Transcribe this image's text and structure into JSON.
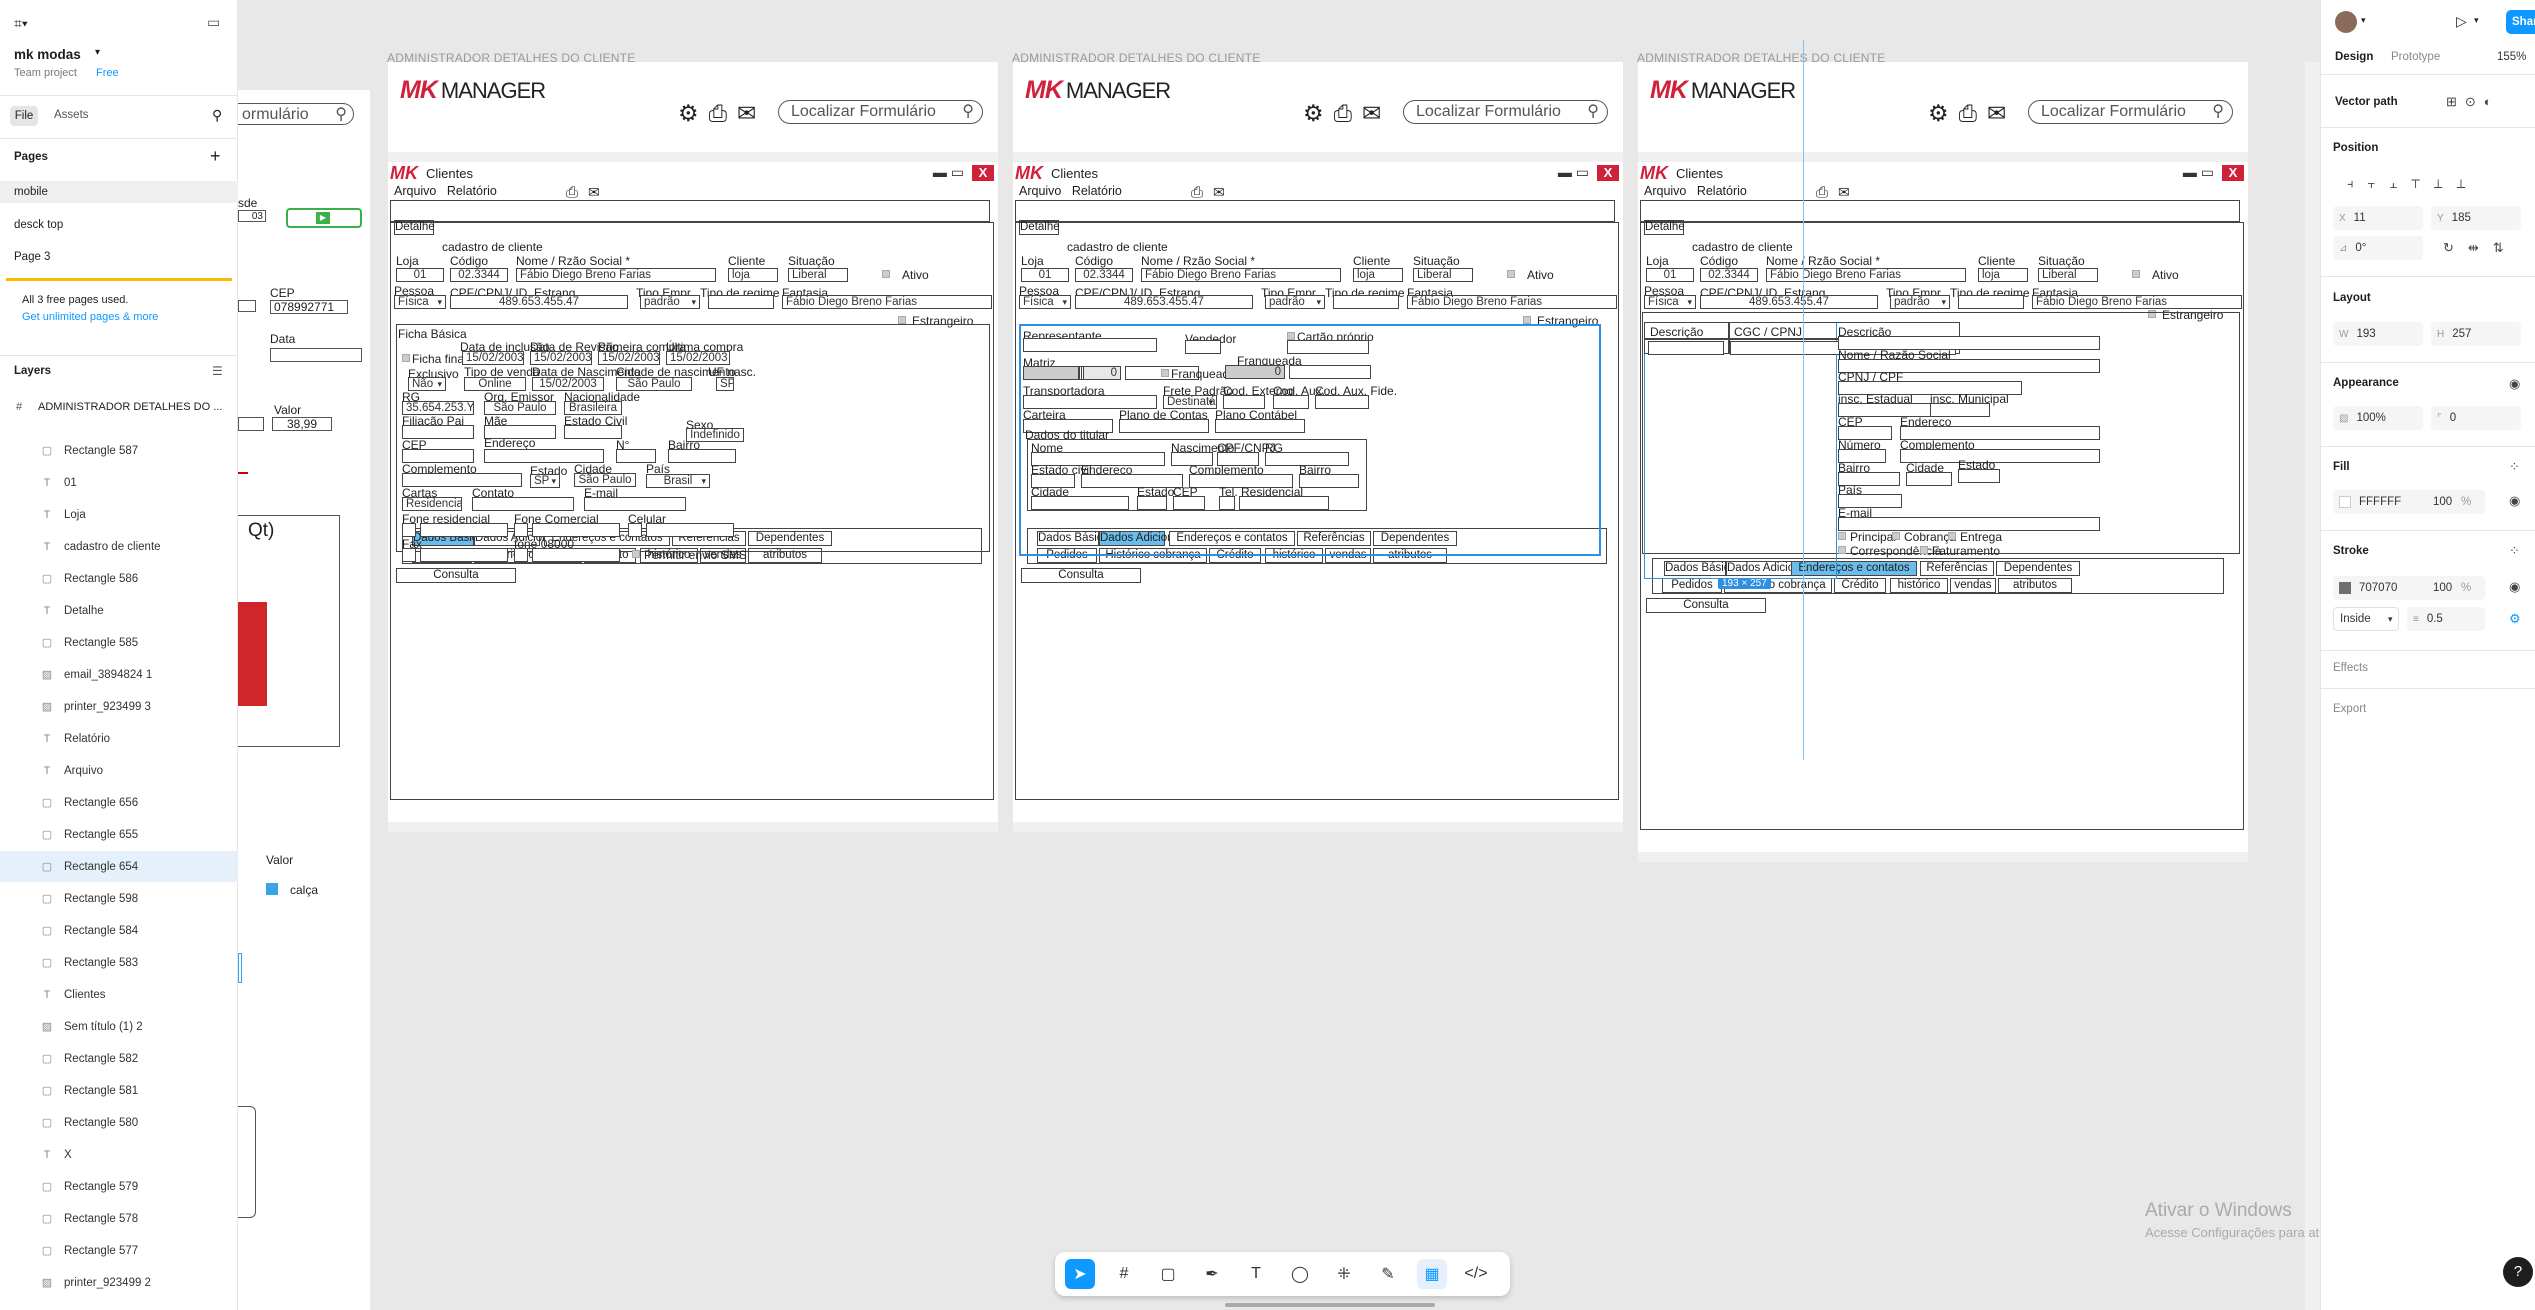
{
  "left_panel": {
    "project": "mk modas",
    "team": "Team project",
    "plan": "Free",
    "tabs": [
      "File",
      "Assets"
    ],
    "pages_title": "Pages",
    "pages": [
      "mobile",
      "desck top",
      "Page 3"
    ],
    "pages_notice": "All 3 free pages used.",
    "pages_link": "Get unlimited pages & more",
    "layers_title": "Layers",
    "frame_layer": "ADMINISTRADOR DETALHES DO ...",
    "layers": [
      {
        "icon": "rect",
        "name": "Rectangle 587"
      },
      {
        "icon": "text",
        "name": "01"
      },
      {
        "icon": "text",
        "name": "Loja"
      },
      {
        "icon": "text",
        "name": "cadastro de cliente"
      },
      {
        "icon": "rect",
        "name": "Rectangle 586"
      },
      {
        "icon": "text",
        "name": "Detalhe"
      },
      {
        "icon": "rect",
        "name": "Rectangle 585"
      },
      {
        "icon": "img",
        "name": "email_3894824 1"
      },
      {
        "icon": "img",
        "name": "printer_923499 3"
      },
      {
        "icon": "text",
        "name": "Relatório"
      },
      {
        "icon": "text",
        "name": "Arquivo"
      },
      {
        "icon": "rect",
        "name": "Rectangle 656"
      },
      {
        "icon": "rect",
        "name": "Rectangle 655"
      },
      {
        "icon": "rect",
        "name": "Rectangle 654"
      },
      {
        "icon": "rect",
        "name": "Rectangle 598"
      },
      {
        "icon": "rect",
        "name": "Rectangle 584"
      },
      {
        "icon": "rect",
        "name": "Rectangle 583"
      },
      {
        "icon": "text",
        "name": "Clientes"
      },
      {
        "icon": "img",
        "name": "Sem título (1) 2"
      },
      {
        "icon": "rect",
        "name": "Rectangle 582"
      },
      {
        "icon": "rect",
        "name": "Rectangle 581"
      },
      {
        "icon": "rect",
        "name": "Rectangle 580"
      },
      {
        "icon": "text",
        "name": "X"
      },
      {
        "icon": "rect",
        "name": "Rectangle 579"
      },
      {
        "icon": "rect",
        "name": "Rectangle 578"
      },
      {
        "icon": "rect",
        "name": "Rectangle 577"
      },
      {
        "icon": "img",
        "name": "printer_923499 2"
      }
    ]
  },
  "partial_frame": {
    "search_text": "ormulário",
    "cep_label": "CEP",
    "cep_value": "078992771",
    "data_label": "Data",
    "valor_label": "Valor",
    "valor_value": "38,99",
    "chart_label": "Qt)",
    "valor_label2": "Valor",
    "legend_item": "calça",
    "sde": "sde",
    "o3": "03"
  },
  "frames": {
    "label": "ADMINISTRADOR DETALHES DO CLIENTE",
    "logo_mk": "MK",
    "logo_manager": "MANAGER",
    "search_placeholder": "Localizar Formulário",
    "window_title": "Clientes",
    "close": "X",
    "menu_arquivo": "Arquivo",
    "menu_relatorio": "Relatório",
    "tab_detalhe": "Detalhe",
    "section_title": "cadastro de cliente",
    "loja": "Loja",
    "loja_v": "01",
    "codigo": "Código",
    "codigo_v": "02.3344",
    "nome": "Nome / Rzão Social *",
    "nome_v": "Fábio Diego Breno Farias",
    "cliente": "Cliente",
    "cliente_v": "loja",
    "situacao": "Situação",
    "situacao_v": "Liberal",
    "ativo": "Ativo",
    "pessoa": "Pessoa",
    "pessoa_v": "Física",
    "cpf": "CPF/CPNJ/ ID. Estrang",
    "cpf_v": "489.653.455.47",
    "tipo_empr": "Tipo Empr.",
    "tipo_empr_v": "padrão",
    "tipo_regime": "Tipo de regime",
    "fantasia": "Fantasia",
    "fantasia_v": "Fábio Diego Breno Farias",
    "estrangeiro": "Estrangeiro",
    "bottom_tabs": [
      "Dados Básicos",
      "Dados Adicionais",
      "Endereços e contatos",
      "Referências",
      "Dependentes"
    ],
    "bottom_tabs2": [
      "Pedidos",
      "Histórico cobrança",
      "Crédito",
      "histórico",
      "vendas",
      "atributos"
    ],
    "consulta": "Consulta"
  },
  "f1": {
    "ficha": "Ficha Básica",
    "ficha_fin": "Ficha financ.",
    "data_inclusao": "Data de inclusão",
    "data_inclusao_v": "15/02/2003",
    "data_revisao": "Data de Revisão",
    "data_revisao_v": "15/02/2003",
    "primeira": "Primeira compra",
    "primeira_v": "15/02/2003",
    "ultima": "Última compra",
    "ultima_v": "15/02/2003",
    "exclusivo": "Exclusivo",
    "exclusivo_v": "Não",
    "tipo_venda": "Tipo de venda",
    "tipo_venda_v": "Online",
    "data_nasc": "Data de Nascimento",
    "data_nasc_v": "15/02/2003",
    "cidade_nasc": "Cidade de nascimento",
    "cidade_nasc_v": "São Paulo",
    "uf": "UF nasc.",
    "uf_v": "SP",
    "rg": "RG",
    "rg_v": "35.654.253.Y",
    "org": "Org. Emissor",
    "org_v": "São Paulo",
    "nacionalidade": "Nacionalidade",
    "nacionalidade_v": "Brasileira",
    "filiacao": "Filiação Pai",
    "mae": "Mãe",
    "estado_civil": "Estado Civil",
    "sexo": "Sexo",
    "sexo_v": "Indefinido",
    "cep": "CEP",
    "endereco": "Endereço",
    "numero": "N°",
    "bairro": "Bairro",
    "complemento": "Complemento",
    "estado": "Estado",
    "estado_v": "SP",
    "cidade": "Cidade",
    "cidade_v": "São Paulo",
    "pais": "País",
    "pais_v": "Brasil",
    "cartas": "Cartas",
    "cartas_v": "Residencial",
    "contato": "Contato",
    "email": "E-mail",
    "fone_res": "Fone residencial",
    "fone_com": "Fone Comercial",
    "celular": "Celular",
    "fax": "Fax",
    "fone0800": "fone 08000",
    "sms": "Permitir envio SMS"
  },
  "f2": {
    "representante": "Representante",
    "vendedor": "Vendedor",
    "cartao": "Cartão próprio",
    "matriz": "Matriz",
    "matriz_v": "0",
    "franqueador": "Franqueador",
    "franqueada": "Franqueada",
    "franqueada_v": "0",
    "transportadora": "Transportadora",
    "frete": "Frete Padrão",
    "frete_v": "Destinatário",
    "cod_ext": "Cod. Externo",
    "cod_aux": "Cod. Aux.",
    "cod_aux_fide": "Cod. Aux. Fide.",
    "carteira": "Carteira",
    "plano_contas": "Plano de Contas",
    "plano_contabil": "Plano Contábel",
    "dados_titular": "Dados do titular",
    "nome": "Nome",
    "nascimento": "Nascimento",
    "cpf_cnpj": "CPF/CNPJ",
    "rg": "RG",
    "estado_civil": "Estado civil",
    "endereco": "Endereço",
    "complemento": "Complemento",
    "bairro": "Bairro",
    "cidade": "Cidade",
    "estado": "Estado",
    "cep": "CEP",
    "tel": "Tel. Residencial"
  },
  "f3": {
    "descricao": "Descrição",
    "cgc": "CGC / CPNJ",
    "size_badge": "193 × 257",
    "descricao2": "Descrição",
    "nome_razao": "Nome / Razão Social",
    "cpnj_cpf": "CPNJ / CPF",
    "insc_est": "insc. Estadual",
    "insc_mun": "insc. Municipal",
    "cep": "CEP",
    "endereco": "Endereço",
    "numero": "Número",
    "complemento": "Complemento",
    "bairro": "Bairro",
    "cidade": "Cidade",
    "estado": "Estado",
    "pais": "País",
    "email": "E-mail",
    "principal": "Principal",
    "cobranca": "Cobrança",
    "entrega": "Entrega",
    "correspondencia": "Correspondência",
    "faturamento": "Faturamento"
  },
  "right_panel": {
    "tabs": [
      "Design",
      "Prototype"
    ],
    "zoom": "155%",
    "share": "Share",
    "node": "Vector path",
    "position": "Position",
    "x": "11",
    "y": "185",
    "rotation": "0°",
    "layout": "Layout",
    "w": "193",
    "h": "257",
    "appearance": "Appearance",
    "opacity": "100%",
    "radius": "0",
    "fill": "Fill",
    "fill_hex": "FFFFFF",
    "fill_pct": "100",
    "stroke": "Stroke",
    "stroke_hex": "707070",
    "stroke_pct": "100",
    "stroke_pos": "Inside",
    "stroke_w": "0.5",
    "effects": "Effects",
    "export": "Export",
    "pct": "%"
  },
  "watermark": {
    "title": "Ativar o Windows",
    "sub": "Acesse Configurações para ativar o Windows."
  }
}
